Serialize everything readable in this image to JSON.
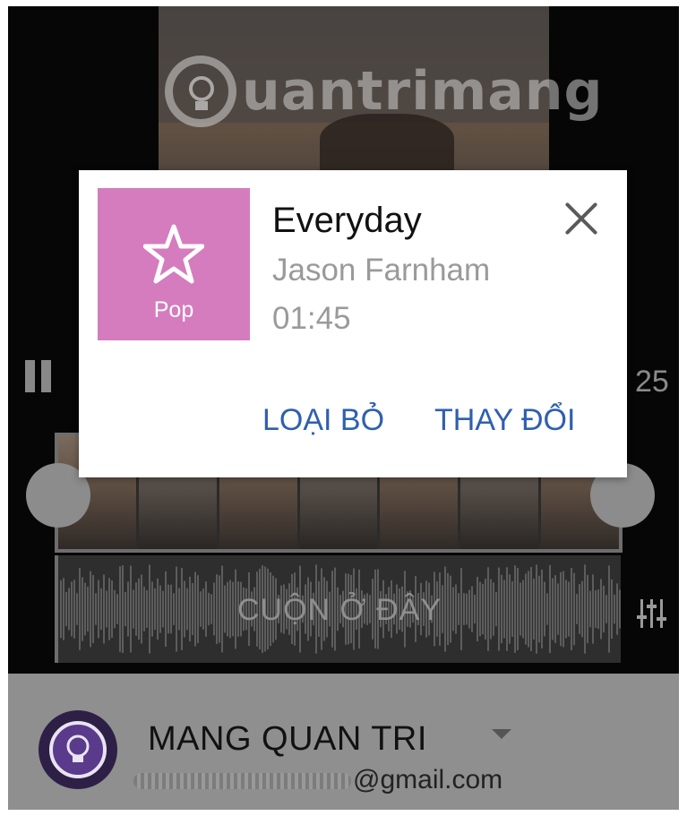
{
  "watermark": {
    "text": "uantrimang"
  },
  "player": {
    "time_partial": "25"
  },
  "timeline": {
    "scroll_hint": "CUỘN Ở ĐÂY"
  },
  "dialog": {
    "genre": "Pop",
    "title": "Everyday",
    "artist": "Jason Farnham",
    "duration": "01:45",
    "remove_label": "LOẠI BỎ",
    "change_label": "THAY ĐỔI"
  },
  "account": {
    "name": "MANG QUAN TRI",
    "email_suffix": "@gmail.com"
  },
  "colors": {
    "genre_tile": "#d47cbe",
    "action_text": "#2f5fb0",
    "account_bar": "#8f8f8f"
  },
  "icons": [
    "pause-icon",
    "close-icon",
    "star-icon",
    "equalizer-icon",
    "chevron-down-icon",
    "lightbulb-logo-icon"
  ]
}
